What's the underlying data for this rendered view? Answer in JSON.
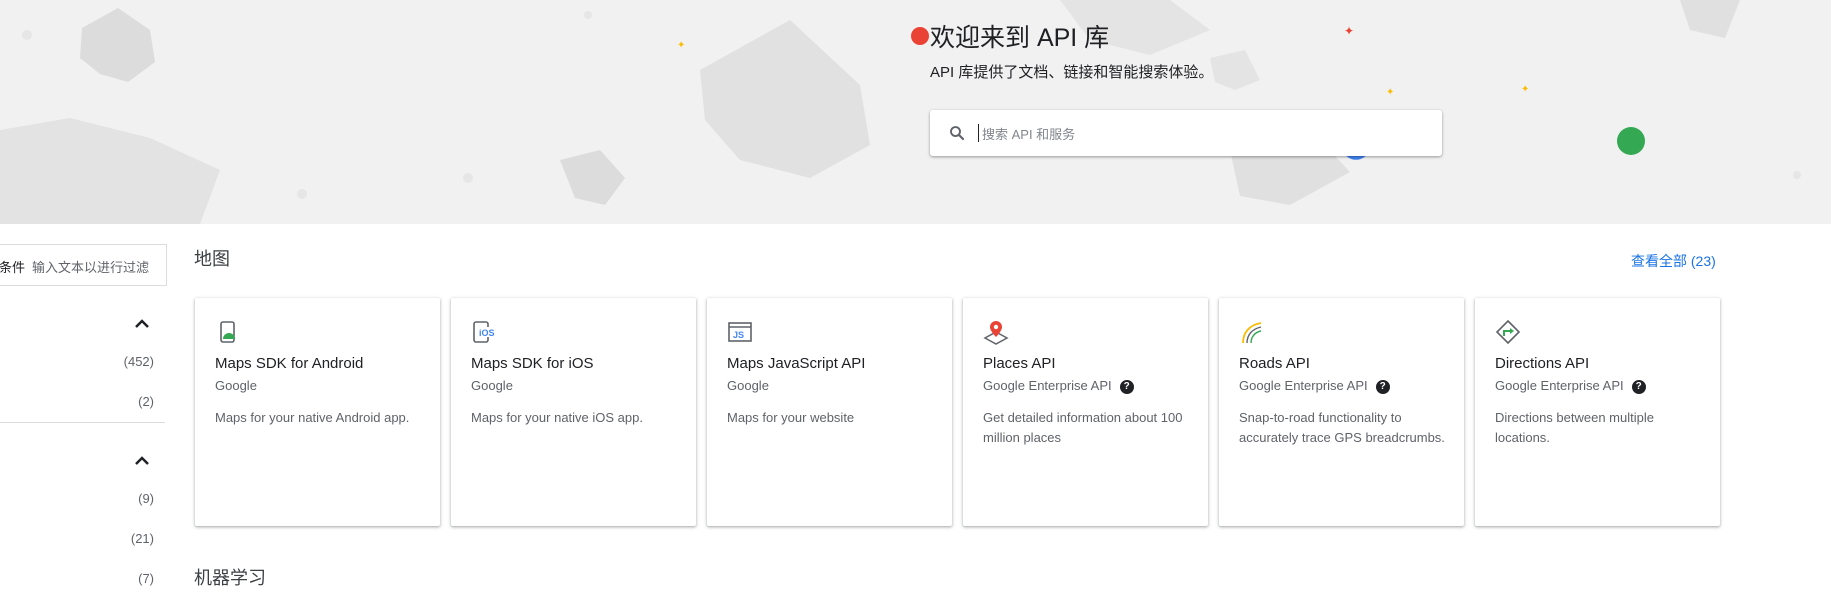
{
  "hero": {
    "title": "欢迎来到 API 库",
    "subtitle": "API 库提供了文档、链接和智能搜索体验。",
    "search_placeholder": "搜索 API 和服务",
    "search_icon": "search-icon"
  },
  "sidebar": {
    "filter_label": "条件",
    "filter_placeholder": "输入文本以进行过滤",
    "group1_counts": [
      "(452)",
      "(2)"
    ],
    "group2_counts": [
      "(9)",
      "(21)",
      "(7)"
    ]
  },
  "sections": [
    {
      "title": "地图",
      "view_all": "查看全部 (23)",
      "cards": [
        {
          "title": "Maps SDK for Android",
          "provider": "Google",
          "has_help": false,
          "description": "Maps for your native Android app.",
          "icon": "android-phone-icon"
        },
        {
          "title": "Maps SDK for iOS",
          "provider": "Google",
          "has_help": false,
          "description": "Maps for your native iOS app.",
          "icon": "ios-phone-icon"
        },
        {
          "title": "Maps JavaScript API",
          "provider": "Google",
          "has_help": false,
          "description": "Maps for your website",
          "icon": "js-window-icon"
        },
        {
          "title": "Places API",
          "provider": "Google Enterprise API",
          "has_help": true,
          "description": "Get detailed information about 100 million places",
          "icon": "place-pin-icon"
        },
        {
          "title": "Roads API",
          "provider": "Google Enterprise API",
          "has_help": true,
          "description": "Snap-to-road functionality to accurately trace GPS breadcrumbs.",
          "icon": "road-icon"
        },
        {
          "title": "Directions API",
          "provider": "Google Enterprise API",
          "has_help": true,
          "description": "Directions between multiple locations.",
          "icon": "directions-icon"
        }
      ]
    },
    {
      "title": "机器学习"
    }
  ],
  "colors": {
    "accent": "#1a73e8",
    "hero_bg": "#f1f1f1",
    "red_dot": "#ea4335",
    "green_dot": "#34a853",
    "blue_dot": "#4285f4"
  }
}
